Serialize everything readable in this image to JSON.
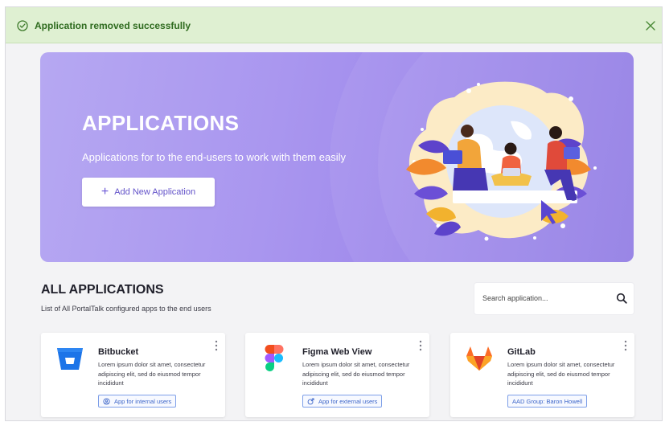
{
  "toast": {
    "message": "Application removed successfully",
    "icon": "check-circle-icon",
    "close_icon": "close-icon",
    "color": "#2f6b1f",
    "background": "#dff0d2"
  },
  "hero": {
    "title": "APPLICATIONS",
    "subtitle": "Applications for to the end-users  to work with them easily",
    "add_button_label": "Add New Application",
    "add_button_icon": "plus-icon",
    "background": "#a996ef"
  },
  "section": {
    "title": "ALL APPLICATIONS",
    "subtitle": "List of All PortalTalk configured apps to the end users"
  },
  "search": {
    "placeholder": "Search application...",
    "icon": "search-icon"
  },
  "apps": [
    {
      "name": "Bitbucket",
      "description": "Lorem ipsum dolor sit amet, consectetur adipiscing elit, sed do eiusmod tempor incididunt",
      "tag": "App for internal users",
      "logo": "bitbucket-logo-icon",
      "tag_icon": "internal-users-icon"
    },
    {
      "name": "Figma Web View",
      "description": "Lorem ipsum dolor sit amet, consectetur adipiscing elit, sed do eiusmod tempor incididunt",
      "tag": "App for external users",
      "logo": "figma-logo-icon",
      "tag_icon": "external-link-icon"
    },
    {
      "name": "GitLab",
      "description": "Lorem ipsum dolor sit amet, consectetur adipiscing elit, sed do eiusmod tempor incididunt",
      "tag": "AAD Group: Baron Howell",
      "logo": "gitlab-logo-icon",
      "tag_icon": ""
    }
  ],
  "colors": {
    "accent": "#6353c9",
    "tag_border": "#7d9fe8",
    "tag_text": "#3d66c9",
    "page_background": "#f3f3f5"
  }
}
